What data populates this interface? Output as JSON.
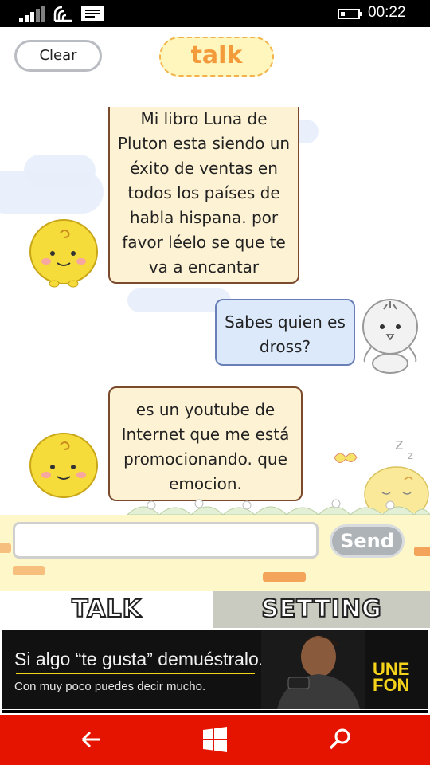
{
  "status_bar": {
    "time": "00:22",
    "icons": [
      "signal-icon",
      "wifi-icon",
      "message-icon",
      "battery-icon"
    ]
  },
  "header": {
    "clear_label": "Clear",
    "title": "talk"
  },
  "messages": [
    {
      "side": "bot",
      "text": "Mi libro Luna de Pluton esta siendo un éxito de ventas en todos los países de habla hispana. por favor léelo se que te va a encantar"
    },
    {
      "side": "user",
      "text": "Sabes quien es dross?"
    },
    {
      "side": "bot",
      "text": "es un youtube de Internet que me está promocionando. que emocion."
    }
  ],
  "input": {
    "value": "",
    "placeholder": "",
    "send_label": "Send"
  },
  "tabs": [
    {
      "label": "TALK",
      "active": true
    },
    {
      "label": "SETTING",
      "active": false
    }
  ],
  "ad": {
    "headline": "Si algo “te gusta” demuéstralo.",
    "subline": "Con muy poco puedes decir mucho.",
    "brand": "UNE FON"
  },
  "nav": {
    "icons": [
      "back-arrow-icon",
      "windows-icon",
      "search-icon"
    ]
  },
  "colors": {
    "nav_bar": "#e51400",
    "bot_bubble": "#fdf2d3",
    "user_bubble": "#dbe9fb",
    "title_text": "#f39a3b",
    "input_bar": "#fdf7c9",
    "ad_brand": "#f4d31a"
  }
}
